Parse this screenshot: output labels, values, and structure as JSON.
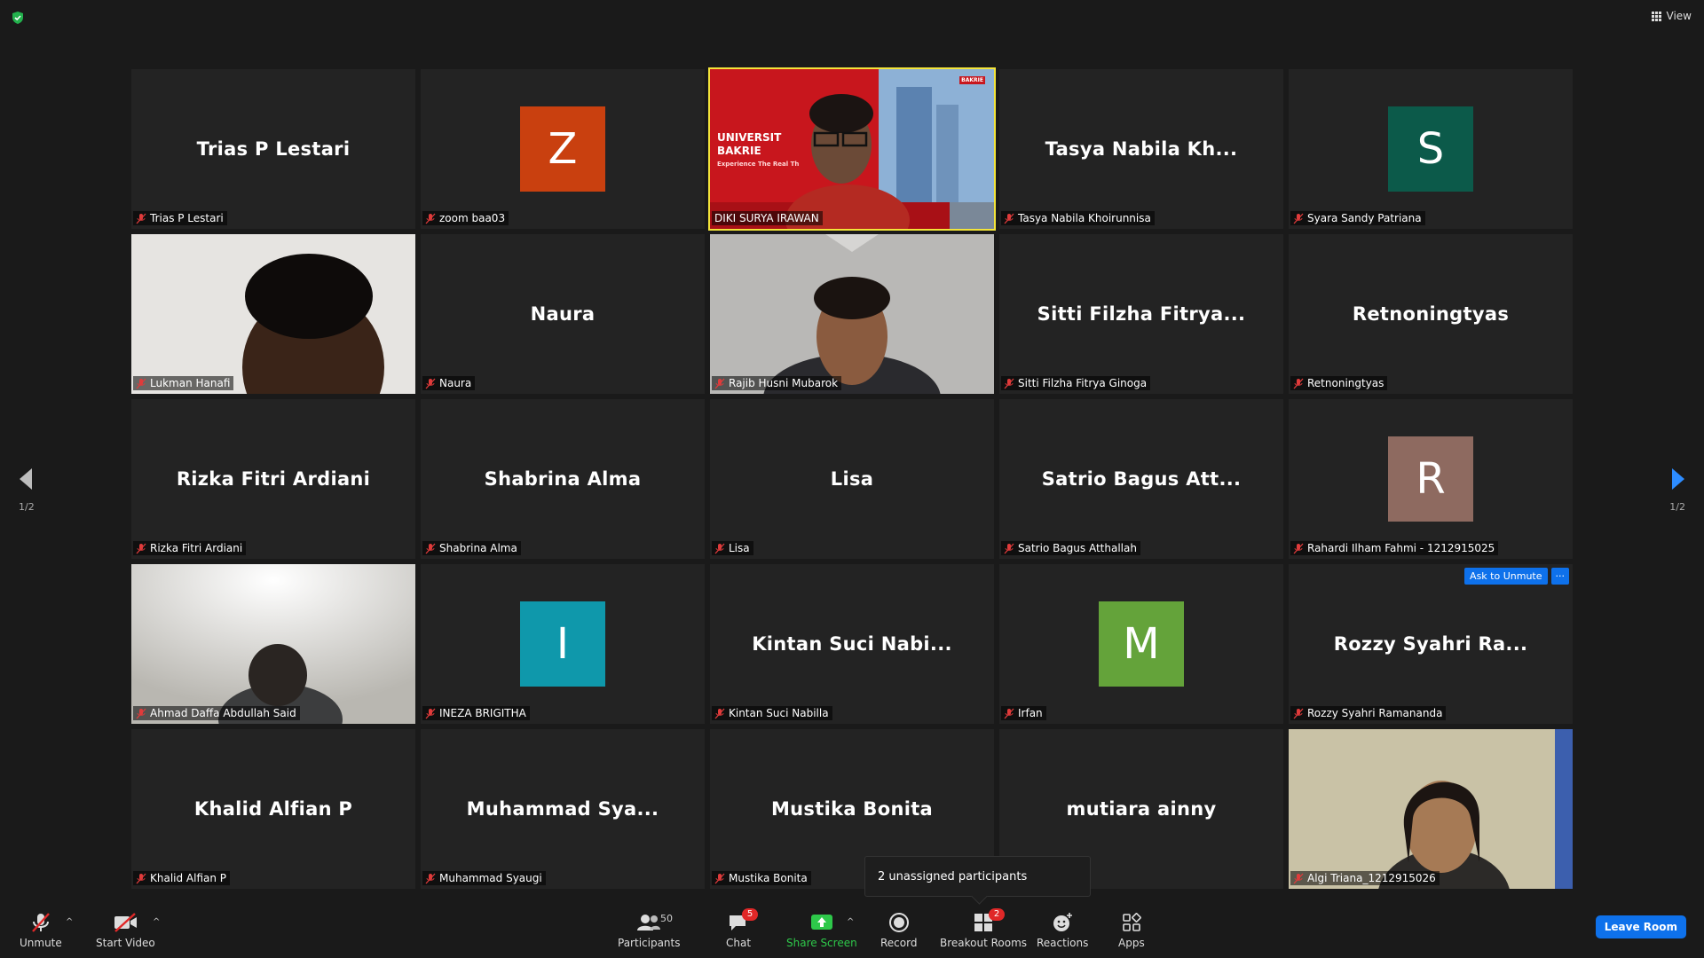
{
  "topbar": {
    "view_label": "View"
  },
  "navigation": {
    "page_indicator_left": "1/2",
    "page_indicator_right": "1/2"
  },
  "tiles": [
    {
      "display": "Trias P Lestari",
      "label": "Trias P Lestari"
    },
    {
      "avatar_letter": "Z",
      "avatar_color": "#c9400f",
      "label": "zoom baa03"
    },
    {
      "video": "Universitas Bakrie slide",
      "slide_title_1": "UNIVERSIT",
      "slide_title_2": "BAKRIE",
      "slide_sub": "Experience The Real Th",
      "slide_logo": "BAKRIE",
      "label": "DIKI SURYA IRAWAN",
      "active": true
    },
    {
      "display": "Tasya Nabila Kh...",
      "label": "Tasya Nabila Khoirunnisa"
    },
    {
      "avatar_letter": "S",
      "avatar_color": "#0c5a4a",
      "label": "Syara Sandy Patriana"
    },
    {
      "video": "camera",
      "label": "Lukman Hanafi"
    },
    {
      "display": "Naura",
      "label": "Naura"
    },
    {
      "video": "camera",
      "label": "Rajib Husni Mubarok"
    },
    {
      "display": "Sitti Filzha Fitrya...",
      "label": "Sitti Filzha Fitrya Ginoga"
    },
    {
      "display": "Retnoningtyas",
      "label": "Retnoningtyas"
    },
    {
      "display": "Rizka Fitri Ardiani",
      "label": "Rizka Fitri Ardiani"
    },
    {
      "display": "Shabrina Alma",
      "label": "Shabrina Alma"
    },
    {
      "display": "Lisa",
      "label": "Lisa"
    },
    {
      "display": "Satrio Bagus Att...",
      "label": "Satrio Bagus Atthallah"
    },
    {
      "avatar_letter": "R",
      "avatar_color": "#8e6a60",
      "label": "Rahardi Ilham Fahmi - 1212915025"
    },
    {
      "video": "camera",
      "label": "Ahmad Daffa Abdullah Said"
    },
    {
      "avatar_letter": "I",
      "avatar_color": "#0f98ab",
      "label": "INEZA BRIGITHA"
    },
    {
      "display": "Kintan Suci Nabi...",
      "label": "Kintan Suci Nabilla"
    },
    {
      "avatar_letter": "M",
      "avatar_color": "#64a33a",
      "label": "Irfan"
    },
    {
      "display": "Rozzy Syahri Ra...",
      "label": "Rozzy Syahri Ramananda",
      "ask_unmute": "Ask to Unmute",
      "more": "···"
    },
    {
      "display": "Khalid Alfian P",
      "label": "Khalid Alfian P"
    },
    {
      "display": "Muhammad Sya...",
      "label": "Muhammad Syaugi"
    },
    {
      "display": "Mustika Bonita",
      "label": "Mustika Bonita"
    },
    {
      "display": "mutiara ainny",
      "label": ""
    },
    {
      "video": "camera",
      "label": "Algi Triana_1212915026"
    }
  ],
  "tooltip": {
    "text": "2 unassigned participants"
  },
  "toolbar": {
    "unmute": "Unmute",
    "start_video": "Start Video",
    "participants": "Participants",
    "participants_count": "50",
    "chat": "Chat",
    "chat_badge": "5",
    "share_screen": "Share Screen",
    "record": "Record",
    "breakout_rooms": "Breakout Rooms",
    "breakout_badge": "2",
    "reactions": "Reactions",
    "apps": "Apps",
    "leave_room": "Leave Room"
  },
  "colors": {
    "accent_blue": "#0e71eb",
    "share_green": "#2ec84a",
    "active_speaker": "#f3e43a",
    "badge_red": "#e02828"
  }
}
